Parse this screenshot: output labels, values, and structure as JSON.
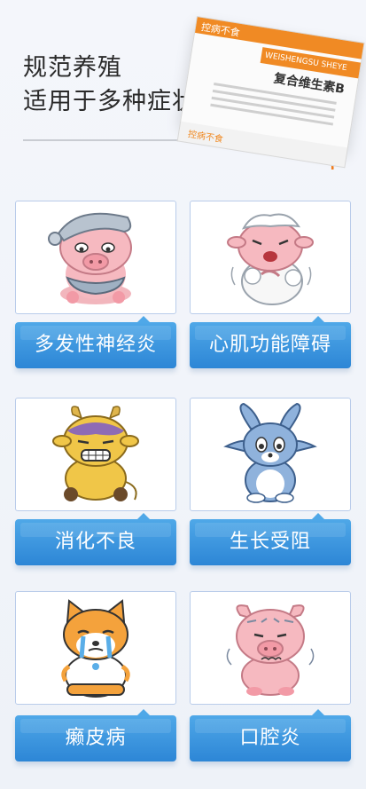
{
  "header": {
    "title_line1": "规范养殖",
    "title_line2": "适用于多种症状"
  },
  "product": {
    "brand": "控病不食",
    "english": "WEISHENGSU SHEYE",
    "name": "复合维生素B"
  },
  "symptoms": [
    {
      "label": "多发性神经炎",
      "icon": "sick-pig-icon"
    },
    {
      "label": "心肌功能障碍",
      "icon": "sick-sheep-icon"
    },
    {
      "label": "消化不良",
      "icon": "sick-cow-icon"
    },
    {
      "label": "生长受阻",
      "icon": "sick-rabbit-icon"
    },
    {
      "label": "癞皮病",
      "icon": "crying-dog-icon"
    },
    {
      "label": "口腔炎",
      "icon": "sick-pig-2-icon"
    }
  ],
  "colors": {
    "label_blue": "#2d86d6",
    "accent_orange": "#f08a24",
    "card_border": "#b9ccea"
  }
}
